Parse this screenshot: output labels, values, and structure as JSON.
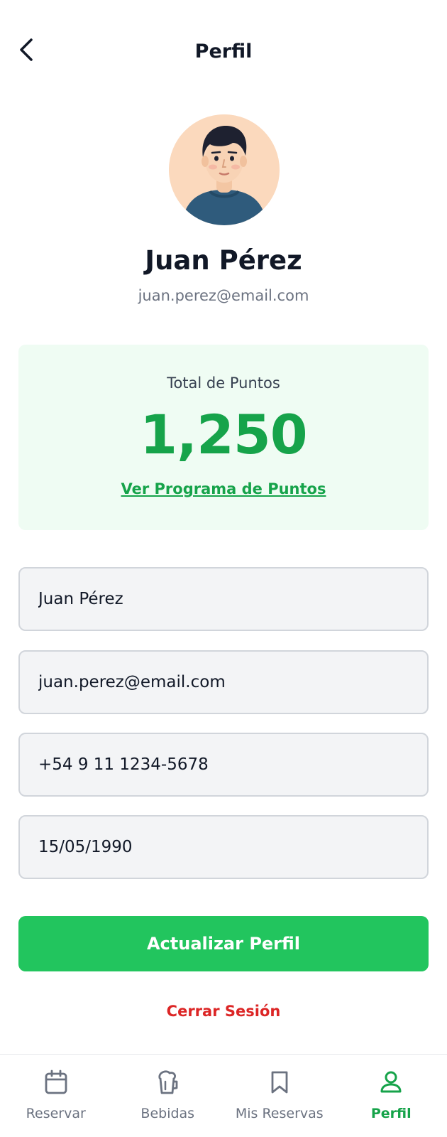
{
  "header": {
    "title": "Perfil",
    "back_icon": "chevron-left-icon"
  },
  "profile": {
    "name": "Juan Pérez",
    "email": "juan.perez@email.com"
  },
  "points": {
    "label": "Total de Puntos",
    "value": "1,250",
    "link": "Ver Programa de Puntos"
  },
  "form": {
    "name_value": "Juan Pérez",
    "email_value": "juan.perez@email.com",
    "phone_value": "+54 9 11 1234-5678",
    "birthdate_value": "15/05/1990"
  },
  "actions": {
    "update_label": "Actualizar Perfil",
    "logout_label": "Cerrar Sesión"
  },
  "nav": {
    "items": [
      {
        "label": "Reservar",
        "icon": "calendar-icon"
      },
      {
        "label": "Bebidas",
        "icon": "drink-icon"
      },
      {
        "label": "Mis Reservas",
        "icon": "bookmark-icon"
      },
      {
        "label": "Perfil",
        "icon": "user-icon",
        "active": true
      }
    ]
  },
  "colors": {
    "accent": "#16a34a",
    "button": "#22c55e",
    "danger": "#dc2626",
    "card_bg": "#effcf3"
  }
}
